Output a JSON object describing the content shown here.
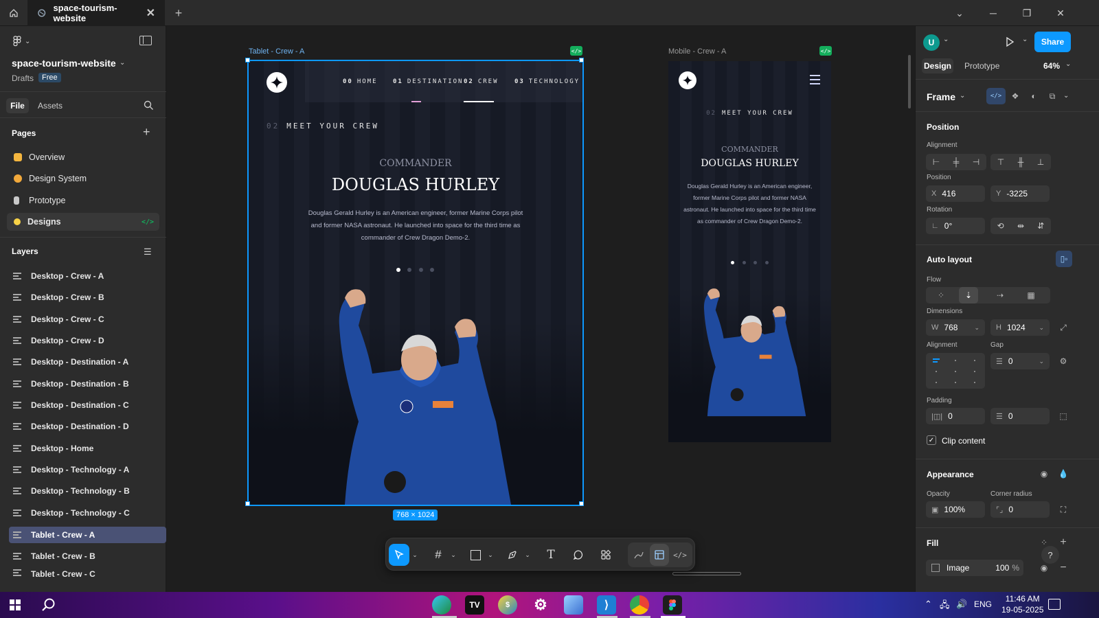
{
  "tabbar": {
    "tab_title": "space-tourism-website"
  },
  "left": {
    "file_name": "space-tourism-website",
    "drafts": "Drafts",
    "plan": "Free",
    "tab_file": "File",
    "tab_assets": "Assets",
    "pages_heading": "Pages",
    "pages": [
      {
        "label": "Overview"
      },
      {
        "label": "Design System"
      },
      {
        "label": "Prototype"
      },
      {
        "label": "Designs"
      }
    ],
    "layers_heading": "Layers",
    "layers": [
      {
        "label": "Desktop - Crew - A"
      },
      {
        "label": "Desktop - Crew - B"
      },
      {
        "label": "Desktop - Crew - C"
      },
      {
        "label": "Desktop - Crew - D"
      },
      {
        "label": "Desktop - Destination - A"
      },
      {
        "label": "Desktop - Destination - B"
      },
      {
        "label": "Desktop - Destination - C"
      },
      {
        "label": "Desktop - Destination - D"
      },
      {
        "label": "Desktop - Home"
      },
      {
        "label": "Desktop - Technology - A"
      },
      {
        "label": "Desktop - Technology - B"
      },
      {
        "label": "Desktop - Technology - C"
      },
      {
        "label": "Tablet - Crew - A"
      },
      {
        "label": "Tablet - Crew - B"
      },
      {
        "label": "Tablet - Crew - C"
      }
    ]
  },
  "canvas": {
    "tablet_label": "Tablet - Crew - A",
    "mobile_label": "Mobile - Crew - A",
    "size_badge": "768 × 1024",
    "nav": [
      {
        "num": "00",
        "label": "HOME"
      },
      {
        "num": "01",
        "label": "DESTINATION"
      },
      {
        "num": "02",
        "label": "CREW"
      },
      {
        "num": "03",
        "label": "TECHNOLOGY"
      }
    ],
    "section_num": "02",
    "section_title": "MEET YOUR CREW",
    "role": "COMMANDER",
    "name": "DOUGLAS HURLEY",
    "bio": "Douglas Gerald Hurley is an American engineer, former Marine Corps pilot and former NASA astronaut. He launched into space for the third time as commander of Crew Dragon Demo-2."
  },
  "right": {
    "avatar": "U",
    "share": "Share",
    "tab_design": "Design",
    "tab_prototype": "Prototype",
    "zoom": "64%",
    "frame_label": "Frame",
    "position_heading": "Position",
    "alignment_label": "Alignment",
    "position_label": "Position",
    "x_label": "X",
    "x_value": "416",
    "y_label": "Y",
    "y_value": "-3225",
    "rotation_label": "Rotation",
    "rotation_value": "0°",
    "autolayout_heading": "Auto layout",
    "flow_label": "Flow",
    "dimensions_label": "Dimensions",
    "w_label": "W",
    "w_value": "768",
    "h_label": "H",
    "h_value": "1024",
    "alignment2_label": "Alignment",
    "gap_label": "Gap",
    "gap_value": "0",
    "padding_label": "Padding",
    "pad_h_value": "0",
    "pad_v_value": "0",
    "clip_label": "Clip content",
    "appearance_heading": "Appearance",
    "opacity_label": "Opacity",
    "opacity_value": "100%",
    "radius_label": "Corner radius",
    "radius_value": "0",
    "fill_heading": "Fill",
    "fill_type": "Image",
    "fill_opacity": "100",
    "fill_pct": "%"
  },
  "taskbar": {
    "lang": "ENG",
    "time": "11:46 AM",
    "date": "19-05-2025"
  },
  "colors": {
    "accent": "#0d99ff",
    "share_bg": "#0d99ff",
    "panel_bg": "#2c2c2c",
    "canvas_bg": "#1e1e1e"
  }
}
